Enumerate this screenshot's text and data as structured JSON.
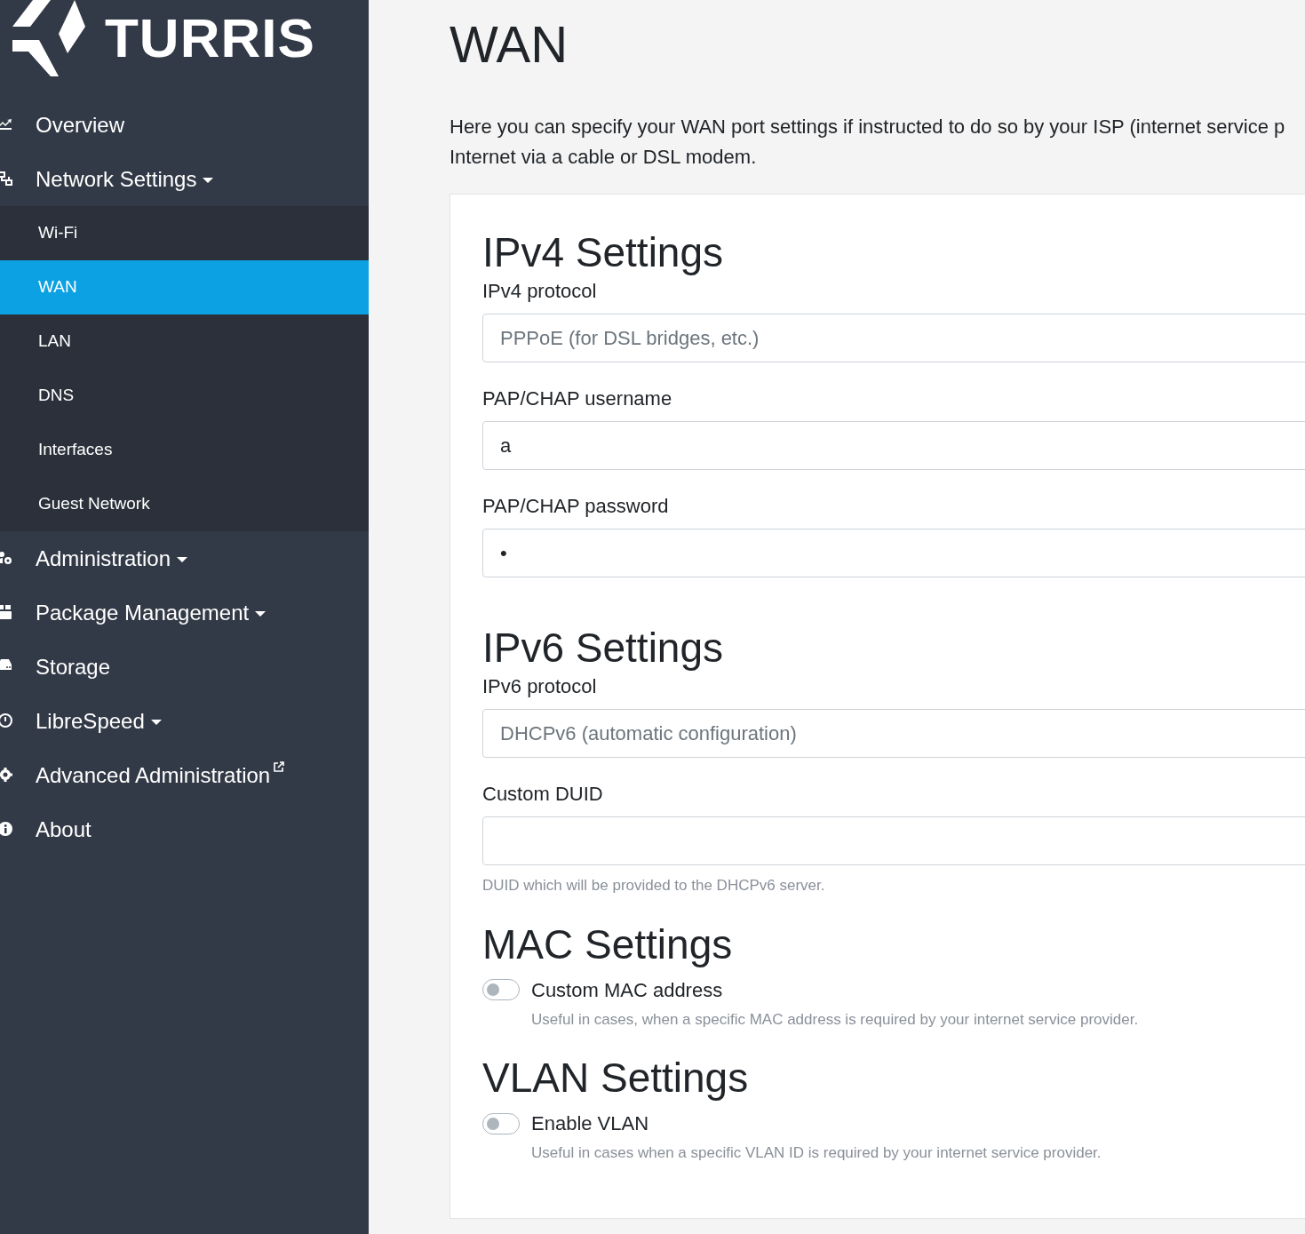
{
  "sidebar": {
    "logo_text": "TURRIS",
    "items": [
      {
        "label": "Overview",
        "dropdown": false,
        "external": false
      },
      {
        "label": "Network Settings",
        "dropdown": true,
        "external": false,
        "expanded": true,
        "children": [
          {
            "label": "Wi-Fi",
            "selected": false
          },
          {
            "label": "WAN",
            "selected": true
          },
          {
            "label": "LAN",
            "selected": false
          },
          {
            "label": "DNS",
            "selected": false
          },
          {
            "label": "Interfaces",
            "selected": false
          },
          {
            "label": "Guest Network",
            "selected": false
          }
        ]
      },
      {
        "label": "Administration",
        "dropdown": true,
        "external": false
      },
      {
        "label": "Package Management",
        "dropdown": true,
        "external": false
      },
      {
        "label": "Storage",
        "dropdown": false,
        "external": false
      },
      {
        "label": "LibreSpeed",
        "dropdown": true,
        "external": false
      },
      {
        "label": "Advanced Administration",
        "dropdown": false,
        "external": true
      },
      {
        "label": "About",
        "dropdown": false,
        "external": false
      }
    ]
  },
  "page": {
    "title": "WAN",
    "intro": [
      "Here you can specify your WAN port settings if instructed to do so by your ISP (internet service p",
      "Internet via a cable or DSL modem."
    ]
  },
  "sections": [
    {
      "heading": "IPv4 Settings",
      "fields": [
        {
          "kind": "select",
          "label": "IPv4 protocol",
          "value": "PPPoE (for DSL bridges, etc.)",
          "disabled": true
        },
        {
          "kind": "text",
          "label": "PAP/CHAP username",
          "value": "a"
        },
        {
          "kind": "text",
          "label": "PAP/CHAP password",
          "value": "•"
        }
      ]
    },
    {
      "heading": "IPv6 Settings",
      "fields": [
        {
          "kind": "select",
          "label": "IPv6 protocol",
          "value": "DHCPv6 (automatic configuration)",
          "disabled": true
        },
        {
          "kind": "text",
          "label": "Custom DUID",
          "help": "DUID which will be provided to the DHCPv6 server."
        }
      ]
    },
    {
      "heading": "MAC Settings",
      "fields": [
        {
          "kind": "switch",
          "label": "Custom MAC address",
          "on": false,
          "help": "Useful in cases, when a specific MAC address is required by your internet service provider."
        }
      ]
    },
    {
      "heading": "VLAN Settings",
      "fields": [
        {
          "kind": "switch",
          "label": "Enable VLAN",
          "on": false,
          "help": "Useful in cases when a specific VLAN ID is required by your internet service provider."
        }
      ]
    }
  ]
}
